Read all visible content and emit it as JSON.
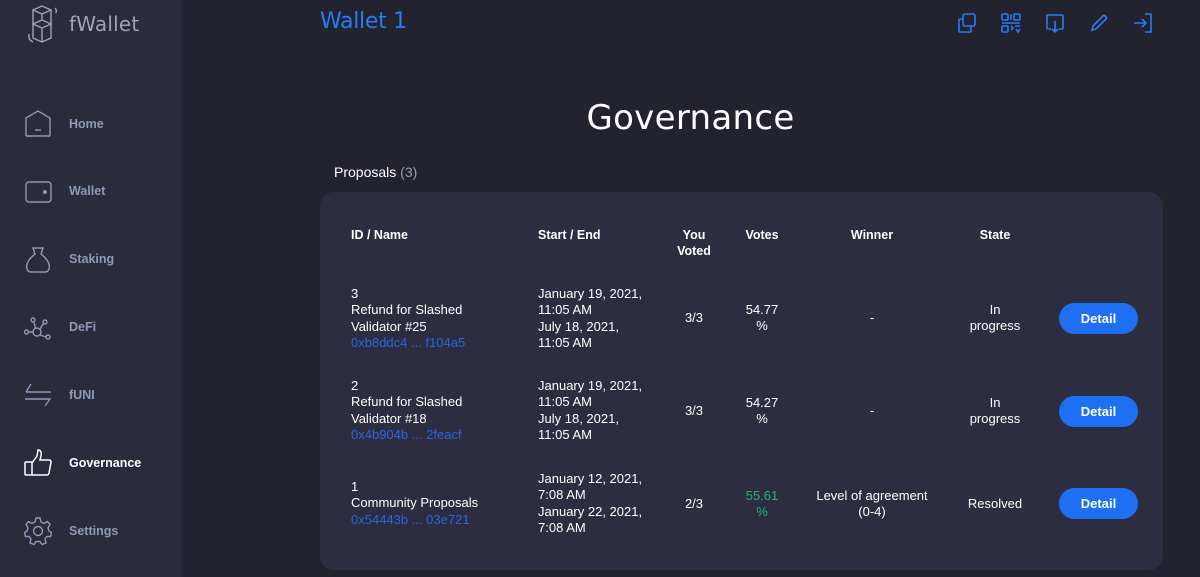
{
  "app": {
    "name": "fWallet"
  },
  "sidebar": {
    "items": [
      {
        "label": "Home",
        "icon": "home-icon",
        "active": false
      },
      {
        "label": "Wallet",
        "icon": "wallet-icon",
        "active": false
      },
      {
        "label": "Staking",
        "icon": "staking-bag-icon",
        "active": false
      },
      {
        "label": "DeFi",
        "icon": "defi-network-icon",
        "active": false
      },
      {
        "label": "fUNI",
        "icon": "swap-arrows-icon",
        "active": false
      },
      {
        "label": "Governance",
        "icon": "thumbs-up-icon",
        "active": true
      },
      {
        "label": "Settings",
        "icon": "gear-icon",
        "active": false
      }
    ]
  },
  "header": {
    "wallet_title": "Wallet 1",
    "actions": [
      {
        "name": "copy-address",
        "icon": "copy-icon"
      },
      {
        "name": "qr-code",
        "icon": "qr-code-icon"
      },
      {
        "name": "receive",
        "icon": "download-icon"
      },
      {
        "name": "rename",
        "icon": "pencil-icon"
      },
      {
        "name": "logout",
        "icon": "logout-icon"
      }
    ],
    "accent_color": "#2a7bf5"
  },
  "main": {
    "title": "Governance",
    "section_label": "Proposals",
    "section_count": "(3)",
    "table": {
      "headers": {
        "id_name": "ID / Name",
        "start_end": "Start / End",
        "you_voted_1": "You",
        "you_voted_2": "Voted",
        "votes": "Votes",
        "winner": "Winner",
        "state": "State"
      },
      "rows": [
        {
          "id": "3",
          "name_1": "Refund for Slashed",
          "name_2": "Validator #25",
          "address": "0xb8ddc4 ... f104a5",
          "start_date": "January 19, 2021,",
          "start_time": "11:05 AM",
          "end_date": "July 18, 2021,",
          "end_time": "11:05 AM",
          "you_voted": "3/3",
          "votes_value": "54.77",
          "votes_unit": "%",
          "winner_1": "-",
          "winner_2": "",
          "state_1": "In",
          "state_2": "progress",
          "button": "Detail"
        },
        {
          "id": "2",
          "name_1": "Refund for Slashed",
          "name_2": "Validator #18",
          "address": "0x4b904b ... 2feacf",
          "start_date": "January 19, 2021,",
          "start_time": "11:05 AM",
          "end_date": "July 18, 2021,",
          "end_time": "11:05 AM",
          "you_voted": "3/3",
          "votes_value": "54.27",
          "votes_unit": "%",
          "winner_1": "-",
          "winner_2": "",
          "state_1": "In",
          "state_2": "progress",
          "button": "Detail"
        },
        {
          "id": "1",
          "name_1": "Community Proposals",
          "name_2": "",
          "address": "0x54443b ... 03e721",
          "start_date": "January 12, 2021,",
          "start_time": "7:08 AM",
          "end_date": "January 22, 2021,",
          "end_time": "7:08 AM",
          "you_voted": "2/3",
          "votes_value": "55.61",
          "votes_unit": "%",
          "winner_1": "Level of agreement",
          "winner_2": "(0-4)",
          "state_1": "Resolved",
          "state_2": "",
          "button": "Detail"
        }
      ]
    }
  },
  "colors": {
    "link": "#2a66e0",
    "success": "#27b56b",
    "button": "#1f6ff2"
  }
}
